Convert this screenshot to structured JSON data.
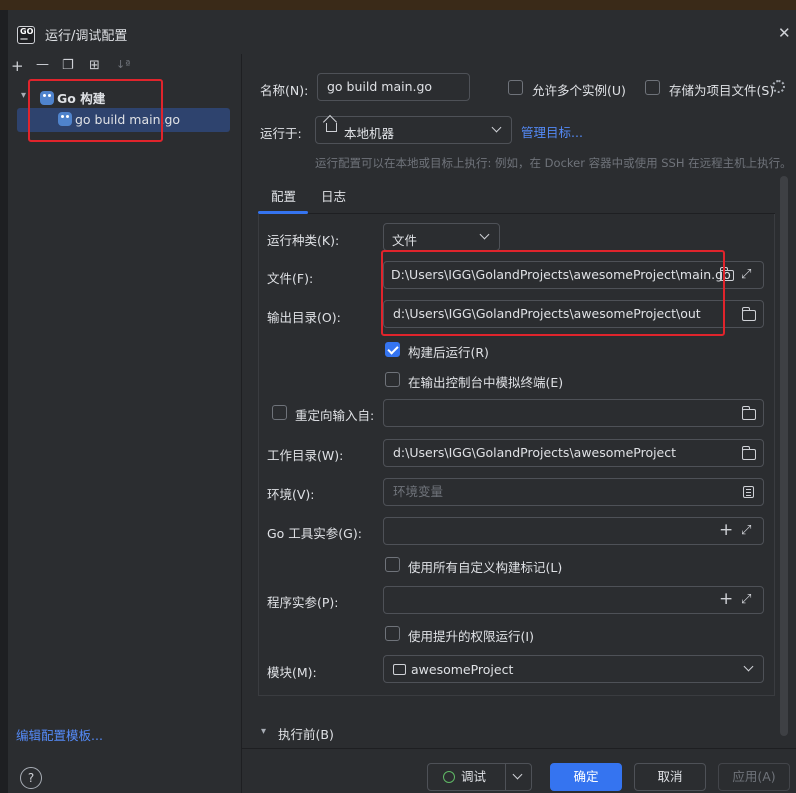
{
  "window": {
    "title": "运行/调试配置",
    "icon_text_top": "GO",
    "icon_text_bottom": "—"
  },
  "left_toolbar": {
    "icons": [
      "add-icon",
      "remove-icon",
      "copy-icon",
      "folder-add-icon",
      "sort-icon"
    ],
    "add": "+",
    "remove": "—",
    "copy": "❐",
    "folder": "⊞",
    "sort": "↓ª"
  },
  "tree": {
    "root_label": "Go 构建",
    "child_label": "go build main.go"
  },
  "left_footer": {
    "edit_templates": "编辑配置模板...",
    "help": "?"
  },
  "form": {
    "name_label": "名称(N):",
    "name_value": "go build main.go",
    "allow_multiple_label": "允许多个实例(U)",
    "allow_multiple_checked": false,
    "store_as_file_label": "存储为项目文件(S)",
    "store_as_file_checked": false,
    "run_on_label": "运行于:",
    "run_on_value": "本地机器",
    "manage_targets": "管理目标...",
    "run_on_hint": "运行配置可以在本地或目标上执行: 例如，在 Docker 容器中或使用 SSH 在远程主机上执行。"
  },
  "tabs": [
    "配置",
    "日志"
  ],
  "active_tab": "配置",
  "config": {
    "run_kind_label": "运行种类(K):",
    "run_kind_value": "文件",
    "files_label": "文件(F):",
    "files_value": "D:\\Users\\IGG\\GolandProjects\\awesomeProject\\main.go",
    "output_dir_label": "输出目录(O):",
    "output_dir_value": "d:\\Users\\IGG\\GolandProjects\\awesomeProject\\out",
    "run_after_build_label": "构建后运行(R)",
    "run_after_build_checked": true,
    "emulate_terminal_label": "在输出控制台中模拟终端(E)",
    "emulate_terminal_checked": false,
    "redirect_input_label": "重定向输入自:",
    "redirect_input_checked": false,
    "redirect_input_value": "",
    "working_dir_label": "工作目录(W):",
    "working_dir_value": "d:\\Users\\IGG\\GolandProjects\\awesomeProject",
    "env_label": "环境(V):",
    "env_placeholder": "环境变量",
    "go_tool_args_label": "Go 工具实参(G):",
    "go_tool_args_value": "",
    "use_custom_tags_label": "使用所有自定义构建标记(L)",
    "use_custom_tags_checked": false,
    "program_args_label": "程序实参(P):",
    "program_args_value": "",
    "elevated_label": "使用提升的权限运行(I)",
    "elevated_checked": false,
    "module_label": "模块(M):",
    "module_value": "awesomeProject"
  },
  "before_launch": {
    "label": "执行前(B)"
  },
  "footer": {
    "debug": "调试",
    "ok": "确定",
    "cancel": "取消",
    "apply": "应用(A)"
  },
  "colors": {
    "background": "#2b2d30",
    "accent": "#3574f0",
    "selection": "#2e436e",
    "link": "#548af7",
    "annotation_red": "#e0242c"
  }
}
